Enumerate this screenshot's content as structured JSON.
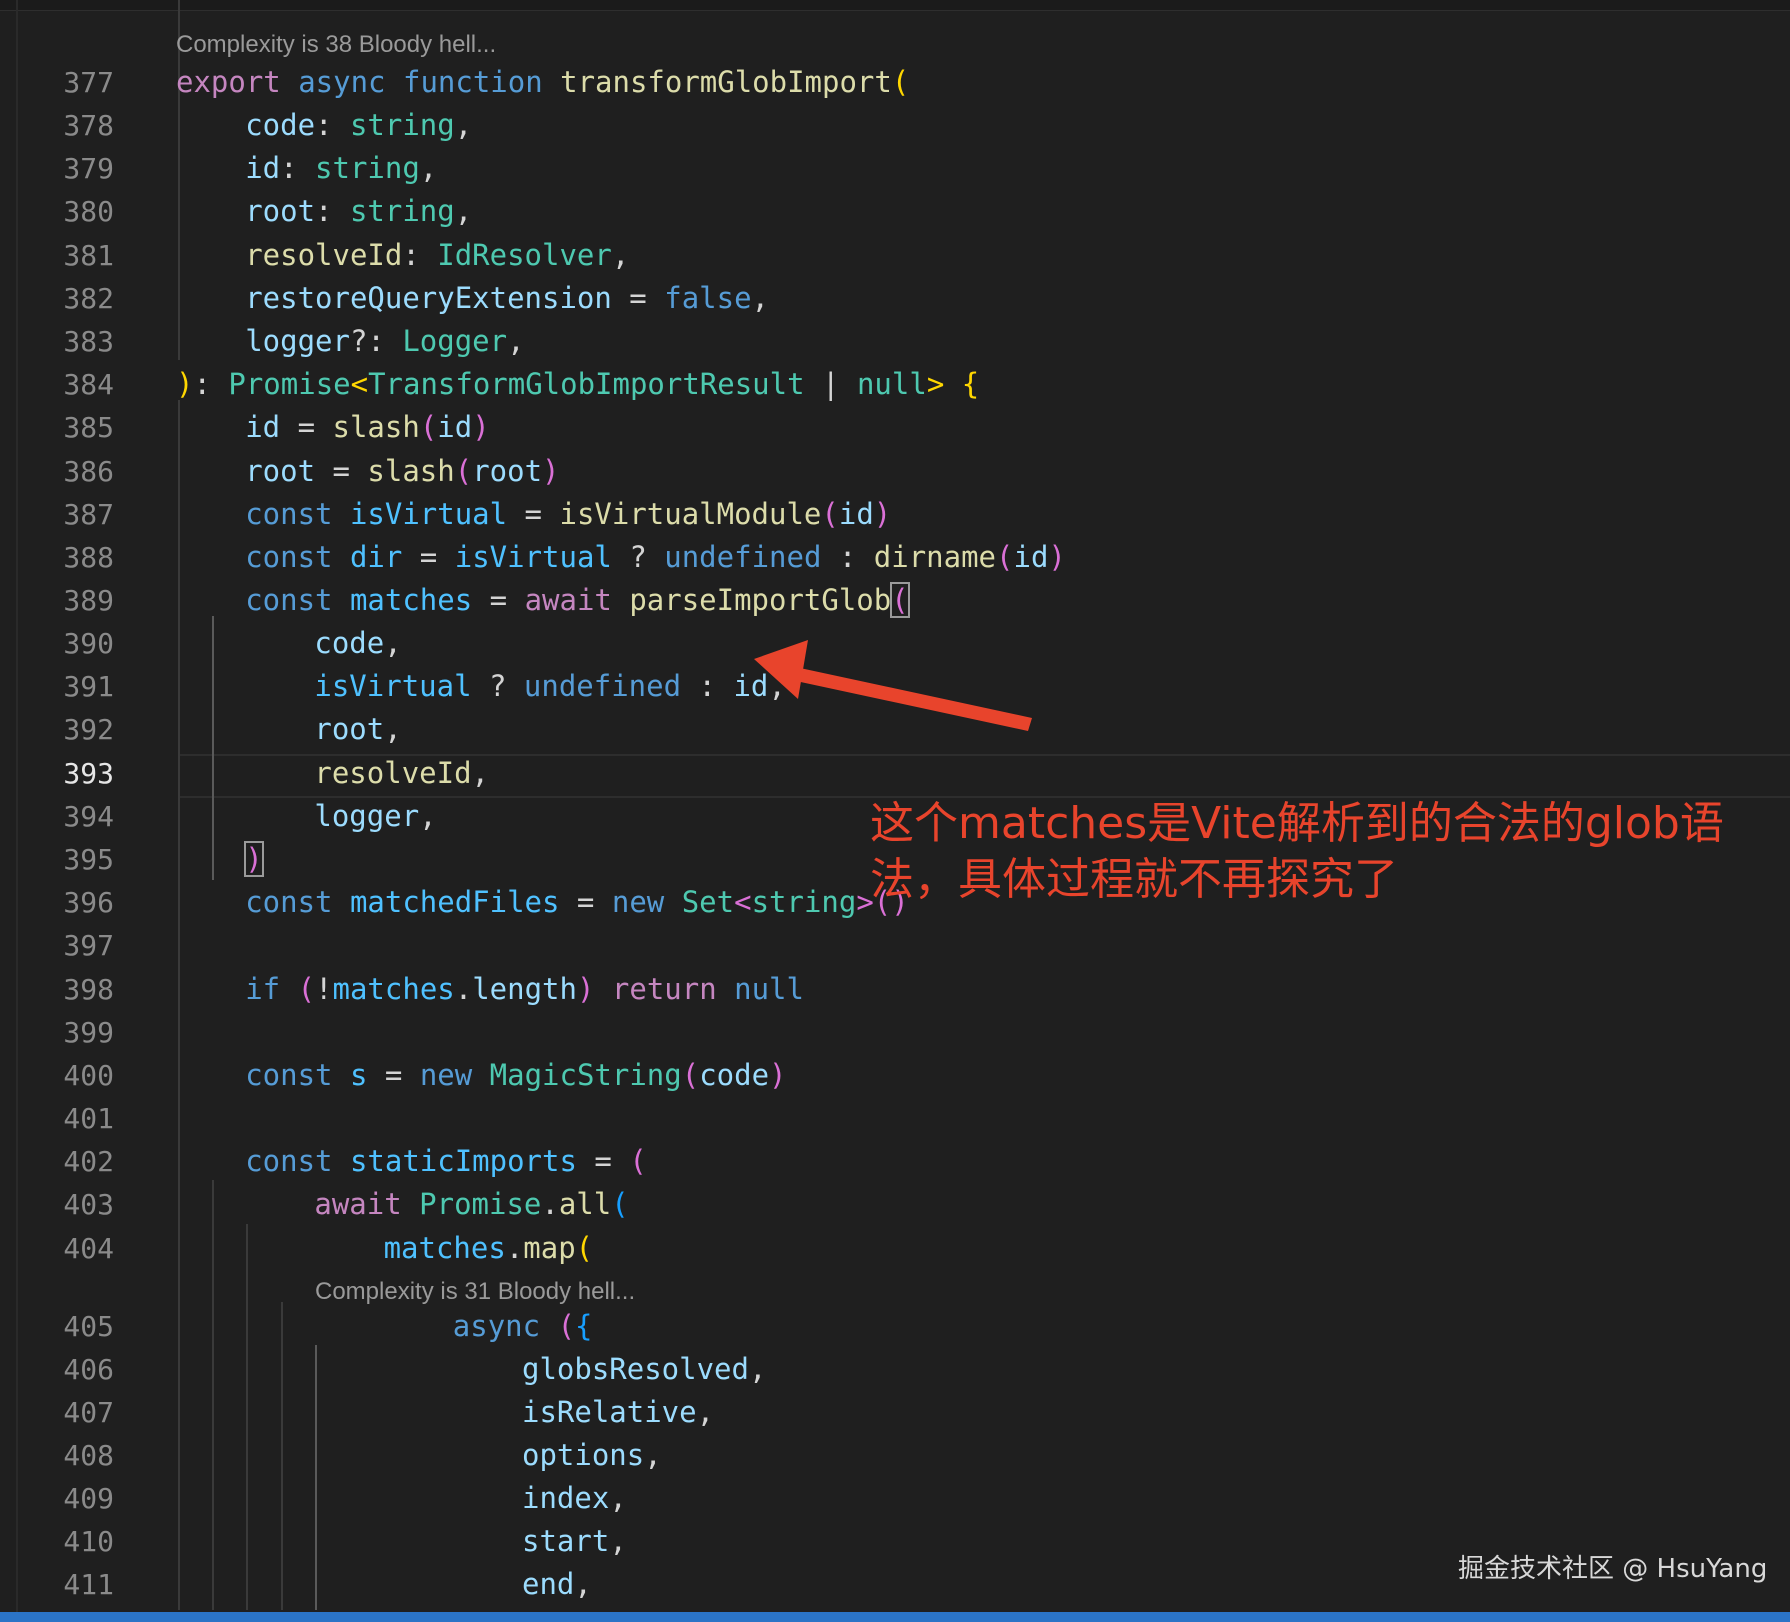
{
  "editor": {
    "codelens": [
      "Complexity is 38 Bloody hell...",
      "Complexity is 31 Bloody hell..."
    ],
    "active_line": "393",
    "lines": [
      {
        "n": "377",
        "tokens": [
          [
            "kw",
            "export "
          ],
          [
            "kw2",
            "async "
          ],
          [
            "kw2",
            "function "
          ],
          [
            "fn",
            "transformGlobImport"
          ],
          [
            "p1",
            "("
          ]
        ]
      },
      {
        "n": "378",
        "tokens": [
          [
            "var",
            "code"
          ],
          [
            "plain",
            ": "
          ],
          [
            "ty",
            "string"
          ],
          [
            "plain",
            ","
          ]
        ]
      },
      {
        "n": "379",
        "tokens": [
          [
            "var",
            "id"
          ],
          [
            "plain",
            ": "
          ],
          [
            "ty",
            "string"
          ],
          [
            "plain",
            ","
          ]
        ]
      },
      {
        "n": "380",
        "tokens": [
          [
            "var",
            "root"
          ],
          [
            "plain",
            ": "
          ],
          [
            "ty",
            "string"
          ],
          [
            "plain",
            ","
          ]
        ]
      },
      {
        "n": "381",
        "tokens": [
          [
            "fn",
            "resolveId"
          ],
          [
            "plain",
            ": "
          ],
          [
            "ty",
            "IdResolver"
          ],
          [
            "plain",
            ","
          ]
        ]
      },
      {
        "n": "382",
        "tokens": [
          [
            "var",
            "restoreQueryExtension"
          ],
          [
            "plain",
            " = "
          ],
          [
            "kw2",
            "false"
          ],
          [
            "plain",
            ","
          ]
        ]
      },
      {
        "n": "383",
        "tokens": [
          [
            "var",
            "logger"
          ],
          [
            "plain",
            "?: "
          ],
          [
            "ty",
            "Logger"
          ],
          [
            "plain",
            ","
          ]
        ]
      },
      {
        "n": "384",
        "tokens": [
          [
            "p1",
            ")"
          ],
          [
            "plain",
            ": "
          ],
          [
            "ty",
            "Promise"
          ],
          [
            "p1",
            "<"
          ],
          [
            "ty",
            "TransformGlobImportResult"
          ],
          [
            "plain",
            " | "
          ],
          [
            "ty",
            "null"
          ],
          [
            "p1",
            "> {"
          ]
        ]
      },
      {
        "n": "385",
        "tokens": [
          [
            "var",
            "id"
          ],
          [
            "plain",
            " = "
          ],
          [
            "fn",
            "slash"
          ],
          [
            "p2",
            "("
          ],
          [
            "var",
            "id"
          ],
          [
            "p2",
            ")"
          ]
        ]
      },
      {
        "n": "386",
        "tokens": [
          [
            "var",
            "root"
          ],
          [
            "plain",
            " = "
          ],
          [
            "fn",
            "slash"
          ],
          [
            "p2",
            "("
          ],
          [
            "var",
            "root"
          ],
          [
            "p2",
            ")"
          ]
        ]
      },
      {
        "n": "387",
        "tokens": [
          [
            "kw2",
            "const "
          ],
          [
            "cst",
            "isVirtual"
          ],
          [
            "plain",
            " = "
          ],
          [
            "fn",
            "isVirtualModule"
          ],
          [
            "p2",
            "("
          ],
          [
            "var",
            "id"
          ],
          [
            "p2",
            ")"
          ]
        ]
      },
      {
        "n": "388",
        "tokens": [
          [
            "kw2",
            "const "
          ],
          [
            "cst",
            "dir"
          ],
          [
            "plain",
            " = "
          ],
          [
            "cst",
            "isVirtual"
          ],
          [
            "plain",
            " ? "
          ],
          [
            "kw2",
            "undefined"
          ],
          [
            "plain",
            " : "
          ],
          [
            "fn",
            "dirname"
          ],
          [
            "p2",
            "("
          ],
          [
            "var",
            "id"
          ],
          [
            "p2",
            ")"
          ]
        ]
      },
      {
        "n": "389",
        "tokens": [
          [
            "kw2",
            "const "
          ],
          [
            "cst",
            "matches"
          ],
          [
            "plain",
            " = "
          ],
          [
            "kw",
            "await "
          ],
          [
            "fn",
            "parseImportGlob"
          ],
          [
            "p2bm",
            "("
          ]
        ]
      },
      {
        "n": "390",
        "tokens": [
          [
            "var",
            "code"
          ],
          [
            "plain",
            ","
          ]
        ]
      },
      {
        "n": "391",
        "tokens": [
          [
            "cst",
            "isVirtual"
          ],
          [
            "plain",
            " ? "
          ],
          [
            "kw2",
            "undefined"
          ],
          [
            "plain",
            " : "
          ],
          [
            "var",
            "id"
          ],
          [
            "plain",
            ","
          ]
        ]
      },
      {
        "n": "392",
        "tokens": [
          [
            "var",
            "root"
          ],
          [
            "plain",
            ","
          ]
        ]
      },
      {
        "n": "393",
        "tokens": [
          [
            "fn",
            "resolveId"
          ],
          [
            "plain",
            ","
          ]
        ]
      },
      {
        "n": "394",
        "tokens": [
          [
            "var",
            "logger"
          ],
          [
            "plain",
            ","
          ]
        ]
      },
      {
        "n": "395",
        "tokens": [
          [
            "p2bm",
            ")"
          ]
        ]
      },
      {
        "n": "396",
        "tokens": [
          [
            "kw2",
            "const "
          ],
          [
            "cst",
            "matchedFiles"
          ],
          [
            "plain",
            " = "
          ],
          [
            "kw2",
            "new "
          ],
          [
            "ty",
            "Set"
          ],
          [
            "p2",
            "<"
          ],
          [
            "ty",
            "string"
          ],
          [
            "p2",
            ">()"
          ]
        ]
      },
      {
        "n": "397",
        "tokens": []
      },
      {
        "n": "398",
        "tokens": [
          [
            "kw2",
            "if "
          ],
          [
            "p2",
            "("
          ],
          [
            "plain",
            "!"
          ],
          [
            "cst",
            "matches"
          ],
          [
            "plain",
            "."
          ],
          [
            "var",
            "length"
          ],
          [
            "p2",
            ")"
          ],
          [
            "plain",
            " "
          ],
          [
            "kw",
            "return "
          ],
          [
            "kw2",
            "null"
          ]
        ]
      },
      {
        "n": "399",
        "tokens": []
      },
      {
        "n": "400",
        "tokens": [
          [
            "kw2",
            "const "
          ],
          [
            "cst",
            "s"
          ],
          [
            "plain",
            " = "
          ],
          [
            "kw2",
            "new "
          ],
          [
            "ty",
            "MagicString"
          ],
          [
            "p2",
            "("
          ],
          [
            "var",
            "code"
          ],
          [
            "p2",
            ")"
          ]
        ]
      },
      {
        "n": "401",
        "tokens": []
      },
      {
        "n": "402",
        "tokens": [
          [
            "kw2",
            "const "
          ],
          [
            "cst",
            "staticImports"
          ],
          [
            "plain",
            " = "
          ],
          [
            "p2",
            "("
          ]
        ]
      },
      {
        "n": "403",
        "tokens": [
          [
            "kw",
            "await "
          ],
          [
            "ty",
            "Promise"
          ],
          [
            "plain",
            "."
          ],
          [
            "fn",
            "all"
          ],
          [
            "p3",
            "("
          ]
        ]
      },
      {
        "n": "404",
        "tokens": [
          [
            "cst",
            "matches"
          ],
          [
            "plain",
            "."
          ],
          [
            "fn",
            "map"
          ],
          [
            "p1",
            "("
          ]
        ]
      },
      {
        "n": "405",
        "tokens": [
          [
            "kw2",
            "async "
          ],
          [
            "p2",
            "("
          ],
          [
            "p3",
            "{"
          ]
        ]
      },
      {
        "n": "406",
        "tokens": [
          [
            "var",
            "globsResolved"
          ],
          [
            "plain",
            ","
          ]
        ]
      },
      {
        "n": "407",
        "tokens": [
          [
            "var",
            "isRelative"
          ],
          [
            "plain",
            ","
          ]
        ]
      },
      {
        "n": "408",
        "tokens": [
          [
            "var",
            "options"
          ],
          [
            "plain",
            ","
          ]
        ]
      },
      {
        "n": "409",
        "tokens": [
          [
            "var",
            "index"
          ],
          [
            "plain",
            ","
          ]
        ]
      },
      {
        "n": "410",
        "tokens": [
          [
            "var",
            "start"
          ],
          [
            "plain",
            ","
          ]
        ]
      },
      {
        "n": "411",
        "tokens": [
          [
            "var",
            "end"
          ],
          [
            "plain",
            ","
          ]
        ]
      }
    ]
  },
  "annotation": {
    "text": "这个matches是Vite解析到的合法的glob语法，具体过程就不再探究了",
    "color": "#e8442c"
  },
  "watermark": "掘金技术社区 @ HsuYang"
}
